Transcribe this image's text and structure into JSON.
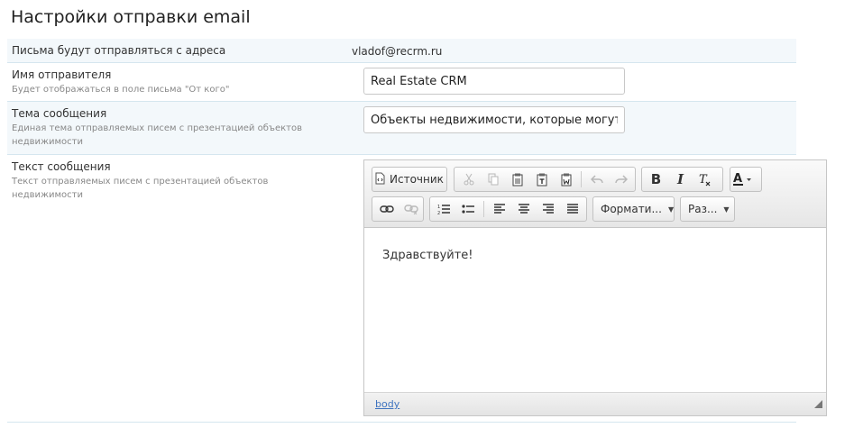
{
  "page": {
    "title": "Настройки отправки email"
  },
  "rows": {
    "from": {
      "label": "Письма будут отправляться с адреса",
      "value": "vladof@recrm.ru"
    },
    "sender": {
      "label": "Имя отправителя",
      "hint": "Будет отображаться в поле письма \"От кого\"",
      "value": "Real Estate CRM"
    },
    "subject": {
      "label": "Тема сообщения",
      "hint": "Единая тема отправляемых писем с презентацией объектов недвижимости",
      "value": "Объекты недвижимости, которые могут быть Вам интересны"
    },
    "body": {
      "label": "Текст сообщения",
      "hint": "Текст отправляемых писем с презентацией объектов недвижимости"
    }
  },
  "editor": {
    "source_label": "Источник",
    "format_label": "Формати...",
    "size_label": "Раз...",
    "content": "Здравствуйте!",
    "path": "body",
    "accent_color": "#3f74c0"
  }
}
